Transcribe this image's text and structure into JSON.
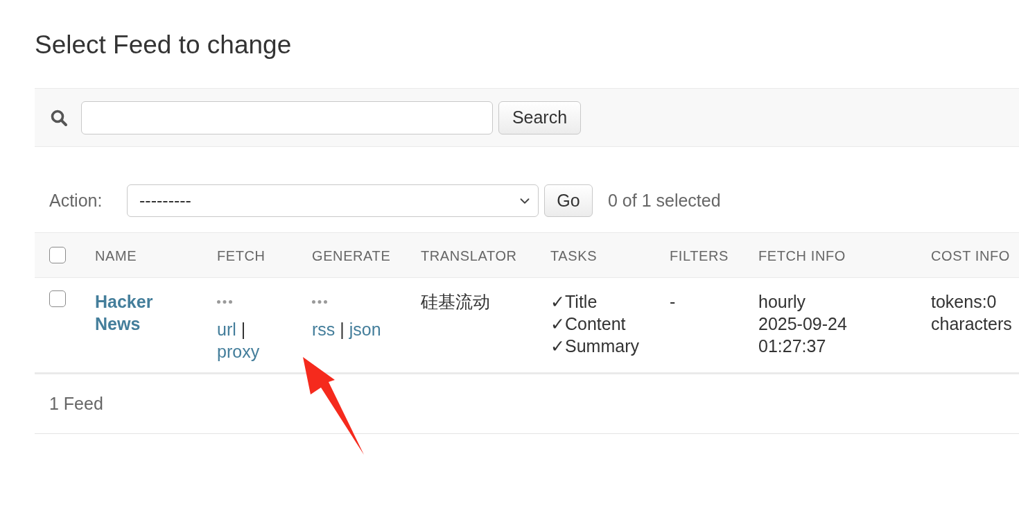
{
  "title": "Select Feed to change",
  "search": {
    "button": "Search"
  },
  "actions": {
    "label": "Action:",
    "value": "---------",
    "button": "Go",
    "selection_count": "0 of 1 selected"
  },
  "table": {
    "select_all": {
      "checked": false
    },
    "columns": [
      "NAME",
      "FETCH",
      "GENERATE",
      "TRANSLATOR",
      "TASKS",
      "FILTERS",
      "FETCH INFO",
      "COST INFO"
    ],
    "rows": [
      {
        "selected": false,
        "name": "Hacker News",
        "fetch": {
          "links": [
            "url",
            "proxy"
          ],
          "separator": "|"
        },
        "generate": {
          "links": [
            "rss",
            "json"
          ],
          "separator": "|"
        },
        "translator": "硅基流动",
        "tasks": [
          "✓Title",
          "✓Content",
          "✓Summary"
        ],
        "filters": "-",
        "fetch_info": [
          "hourly",
          "2025-09-24",
          "01:27:37"
        ],
        "cost_info": [
          "tokens:0",
          "characters"
        ]
      }
    ]
  },
  "result_count": "1 Feed",
  "annotation": {
    "kind": "arrow"
  }
}
